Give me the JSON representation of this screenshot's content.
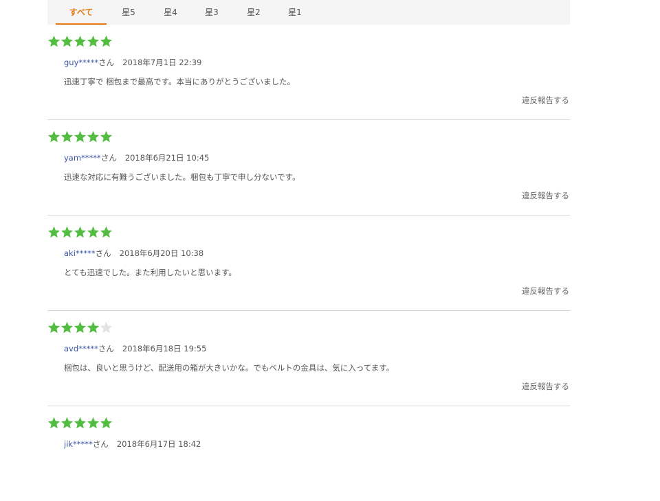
{
  "colors": {
    "accent": "#e47911",
    "star_filled": "#52bd41",
    "star_empty": "#e3e3e3",
    "reviewer": "#3a57a8"
  },
  "tabs": [
    {
      "label": "すべて",
      "active": true
    },
    {
      "label": "星5",
      "active": false
    },
    {
      "label": "星4",
      "active": false
    },
    {
      "label": "星3",
      "active": false
    },
    {
      "label": "星2",
      "active": false
    },
    {
      "label": "星1",
      "active": false
    }
  ],
  "reviews": [
    {
      "rating": 5,
      "reviewer": "guy*****",
      "suffix": "さん",
      "date": "2018年7月1日 22:39",
      "text": "迅速丁寧で 梱包まで最高です。本当にありがとうございました。",
      "report": "違反報告する"
    },
    {
      "rating": 5,
      "reviewer": "yam*****",
      "suffix": "さん",
      "date": "2018年6月21日 10:45",
      "text": "迅速な対応に有難うございました。梱包も丁寧で申し分ないです。",
      "report": "違反報告する"
    },
    {
      "rating": 5,
      "reviewer": "aki*****",
      "suffix": "さん",
      "date": "2018年6月20日 10:38",
      "text": "とても迅速でした。また利用したいと思います。",
      "report": "違反報告する"
    },
    {
      "rating": 4,
      "reviewer": "avd*****",
      "suffix": "さん",
      "date": "2018年6月18日 19:55",
      "text": "梱包は、良いと思うけど、配送用の箱が大きいかな。でもベルトの金具は、気に入ってます。",
      "report": "違反報告する"
    },
    {
      "rating": 5,
      "reviewer": "jik*****",
      "suffix": "さん",
      "date": "2018年6月17日 18:42",
      "text": "",
      "report": ""
    }
  ]
}
